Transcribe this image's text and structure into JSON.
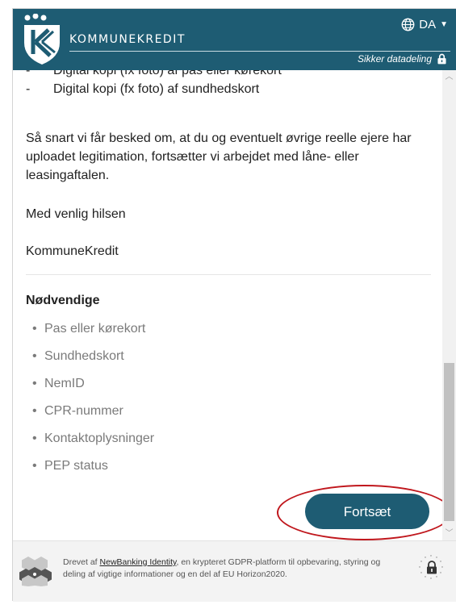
{
  "header": {
    "brand": "KOMMUNEKREDIT",
    "language": "DA",
    "secure_label": "Sikker datadeling",
    "colors": {
      "primary": "#1e5c73"
    }
  },
  "content": {
    "documents": [
      "Digital kopi (fx foto) af pas eller kørekort",
      "Digital kopi (fx foto) af sundhedskort"
    ],
    "paragraph": "Så snart vi får besked om, at du og eventuelt øvrige reelle ejere har uploadet legitimation, fortsætter vi arbejdet med låne- eller leasingaftalen.",
    "greeting": "Med venlig hilsen",
    "signature": "KommuneKredit",
    "section_title": "Nødvendige",
    "required_items": [
      "Pas eller kørekort",
      "Sundhedskort",
      "NemID",
      "CPR-nummer",
      "Kontaktoplysninger",
      "PEP status"
    ],
    "continue_button": "Fortsæt"
  },
  "footer": {
    "prefix": "Drevet af ",
    "link": "NewBanking Identity",
    "suffix": ", en krypteret GDPR-platform til opbevaring, styring og deling af vigtige informationer og en del af EU Horizon2020."
  },
  "icons": [
    "kommunekredit-logo-icon",
    "globe-icon",
    "caret-down-icon",
    "lock-icon",
    "newbanking-logo-icon",
    "eu-lock-icon"
  ]
}
